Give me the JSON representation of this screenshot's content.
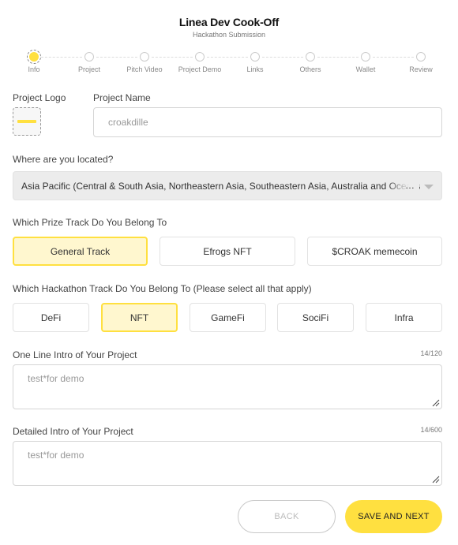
{
  "header": {
    "title": "Linea Dev Cook-Off",
    "subtitle": "Hackathon Submission"
  },
  "steps": [
    {
      "label": "Info",
      "active": true
    },
    {
      "label": "Project"
    },
    {
      "label": "Pitch Video"
    },
    {
      "label": "Project Demo"
    },
    {
      "label": "Links"
    },
    {
      "label": "Others"
    },
    {
      "label": "Wallet"
    },
    {
      "label": "Review"
    }
  ],
  "project": {
    "logo_label": "Project Logo",
    "name_label": "Project Name",
    "name_value": "croakdille"
  },
  "location": {
    "label": "Where are you located?",
    "selected": "Asia Pacific (Central & South Asia, Northeastern Asia, Southeastern Asia, Australia and Oceania)"
  },
  "prize_track": {
    "label": "Which Prize Track Do You Belong To",
    "options": [
      "General Track",
      "Efrogs NFT",
      "$CROAK memecoin"
    ],
    "selected": "General Track"
  },
  "hackathon_track": {
    "label": "Which Hackathon Track Do You Belong To (Please select all that apply)",
    "options": [
      "DeFi",
      "NFT",
      "GameFi",
      "SociFi",
      "Infra"
    ],
    "selected": [
      "NFT"
    ]
  },
  "one_line_intro": {
    "label": "One Line Intro of Your Project",
    "counter": "14/120",
    "value": "test*for demo"
  },
  "detailed_intro": {
    "label": "Detailed Intro of Your Project",
    "counter": "14/600",
    "value": "test*for demo"
  },
  "buttons": {
    "back": "BACK",
    "next": "SAVE AND NEXT"
  },
  "colors": {
    "accent": "#ffe040",
    "selected_bg": "#fff7cf"
  }
}
